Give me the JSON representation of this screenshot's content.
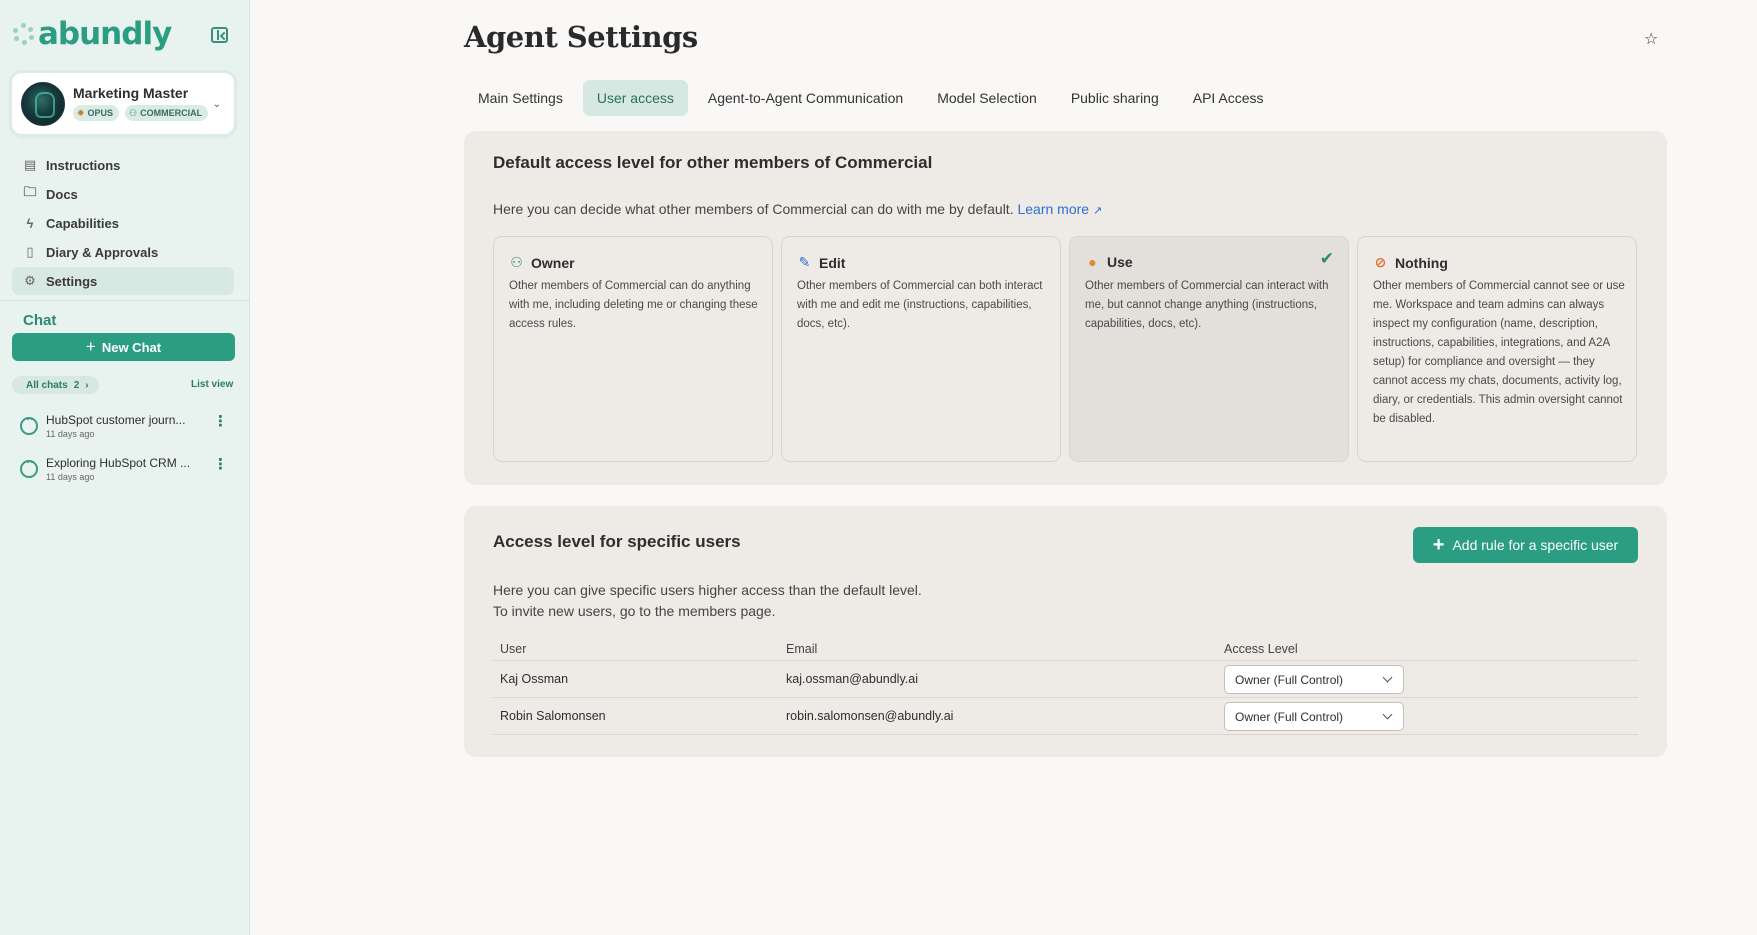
{
  "sidebar": {
    "logo_text": "abundly",
    "agent": {
      "name": "Marketing Master",
      "badges": [
        "OPUS",
        "COMMERCIAL"
      ]
    },
    "nav": [
      {
        "label": "Instructions",
        "icon": "document-icon"
      },
      {
        "label": "Docs",
        "icon": "folder-icon"
      },
      {
        "label": "Capabilities",
        "icon": "bolt-icon"
      },
      {
        "label": "Diary & Approvals",
        "icon": "book-icon"
      },
      {
        "label": "Settings",
        "icon": "gear-icon",
        "active": true
      }
    ],
    "chat_section": {
      "title": "Chat",
      "new_chat_label": "New Chat",
      "all_chats_label": "All chats",
      "all_chats_count": "2",
      "list_view_label": "List view",
      "chats": [
        {
          "name": "HubSpot customer journ...",
          "time": "11 days ago"
        },
        {
          "name": "Exploring HubSpot CRM ...",
          "time": "11 days ago"
        }
      ]
    }
  },
  "header": {
    "title": "Agent Settings",
    "tabs": [
      {
        "label": "Main Settings"
      },
      {
        "label": "User access",
        "active": true
      },
      {
        "label": "Agent-to-Agent Communication"
      },
      {
        "label": "Model Selection"
      },
      {
        "label": "Public sharing"
      },
      {
        "label": "API Access"
      }
    ]
  },
  "default_access": {
    "title": "Default access level for other members of Commercial",
    "description": "Here you can decide what other members of Commercial can do with me by default.",
    "learn_more": "Learn more",
    "options": [
      {
        "title": "Owner",
        "icon": "owner-icon",
        "description": "Other members of Commercial can do anything with me, including deleting me or changing these access rules."
      },
      {
        "title": "Edit",
        "icon": "edit-icon",
        "description": "Other members of Commercial can both interact with me and edit me (instructions, capabilities, docs, etc)."
      },
      {
        "title": "Use",
        "icon": "user-icon",
        "selected": true,
        "description": "Other members of Commercial can interact with me, but cannot change anything (instructions, capabilities, docs, etc)."
      },
      {
        "title": "Nothing",
        "icon": "blocked-user-icon",
        "description": "Other members of Commercial cannot see or use me. Workspace and team admins can always inspect my configuration (name, description, instructions, capabilities, integrations, and A2A setup) for compliance and oversight — they cannot access my chats, documents, activity log, diary, or credentials. This admin oversight cannot be disabled."
      }
    ]
  },
  "specific_access": {
    "title": "Access level for specific users",
    "add_rule_label": "Add rule for a specific user",
    "description_line1": "Here you can give specific users higher access than the default level.",
    "description_line2": "To invite new users, go to the members page.",
    "columns": {
      "user": "User",
      "email": "Email",
      "level": "Access Level"
    },
    "rows": [
      {
        "user": "Kaj Ossman",
        "email": "kaj.ossman@abundly.ai",
        "level": "Owner (Full Control)"
      },
      {
        "user": "Robin Salomonsen",
        "email": "robin.salomonsen@abundly.ai",
        "level": "Owner (Full Control)"
      }
    ]
  },
  "colors": {
    "accent": "#2a9d83",
    "sidebar_bg": "#e8f2ef",
    "panel_bg": "#eeeae5",
    "link": "#2b6fd1"
  }
}
